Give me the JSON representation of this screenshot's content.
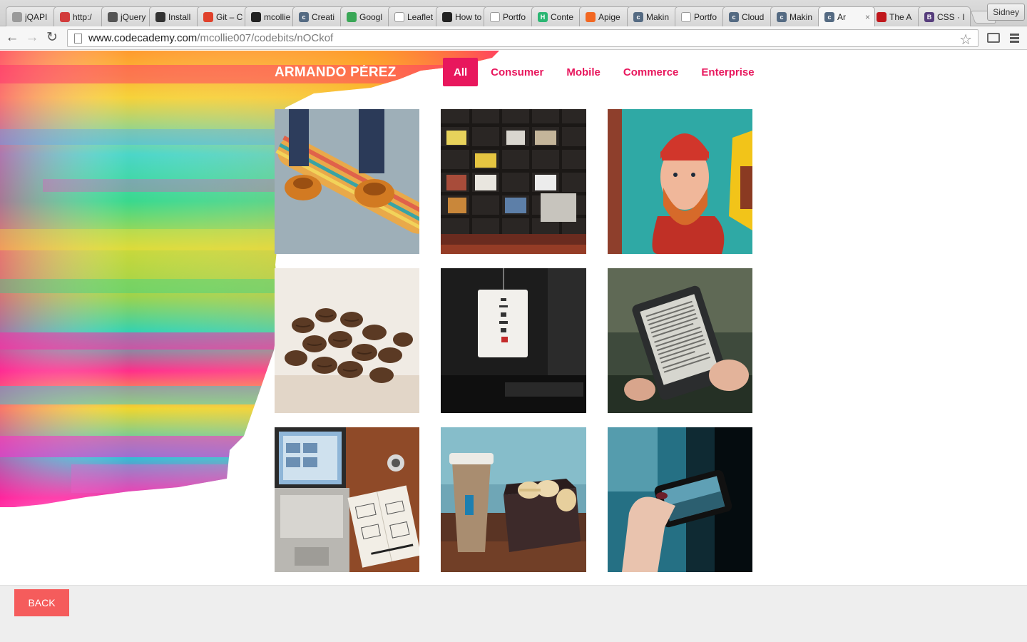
{
  "browser": {
    "tabs": [
      {
        "label": "jQAPI",
        "fav_color": "#9a9a9a",
        "fav_glyph": ""
      },
      {
        "label": "http:/",
        "fav_color": "#d23c3c",
        "fav_glyph": ""
      },
      {
        "label": "jQuery",
        "fav_color": "#555555",
        "fav_glyph": ""
      },
      {
        "label": "Install",
        "fav_color": "#333333",
        "fav_glyph": ""
      },
      {
        "label": "Git – C",
        "fav_color": "#e0412b",
        "fav_glyph": ""
      },
      {
        "label": "mcollie",
        "fav_color": "#222222",
        "fav_glyph": ""
      },
      {
        "label": "Creati",
        "fav_color": "#546a82",
        "fav_glyph": "c"
      },
      {
        "label": "Googl",
        "fav_color": "#3aa757",
        "fav_glyph": ""
      },
      {
        "label": "Leaflet",
        "fav_color": "#ffffff",
        "fav_glyph": ""
      },
      {
        "label": "How to",
        "fav_color": "#222222",
        "fav_glyph": ""
      },
      {
        "label": "Portfo",
        "fav_color": "#ffffff",
        "fav_glyph": ""
      },
      {
        "label": "Conte",
        "fav_color": "#2bb673",
        "fav_glyph": "H"
      },
      {
        "label": "Apige",
        "fav_color": "#f26722",
        "fav_glyph": ""
      },
      {
        "label": "Makin",
        "fav_color": "#546a82",
        "fav_glyph": "c"
      },
      {
        "label": "Portfo",
        "fav_color": "#ffffff",
        "fav_glyph": ""
      },
      {
        "label": "Cloud",
        "fav_color": "#546a82",
        "fav_glyph": "c"
      },
      {
        "label": "Makin",
        "fav_color": "#546a82",
        "fav_glyph": "c"
      },
      {
        "label": "Ar",
        "fav_color": "#546a82",
        "fav_glyph": "c",
        "active": true
      },
      {
        "label": "The A",
        "fav_color": "#c0171c",
        "fav_glyph": ""
      },
      {
        "label": "CSS · I",
        "fav_color": "#563d7c",
        "fav_glyph": "B"
      }
    ],
    "tab_close_glyph": "×",
    "profile_name": "Sidney",
    "url_host": "www.codecademy.com",
    "url_path": "/mcollie007/codebits/nOCkof",
    "back_glyph": "←",
    "forward_glyph": "→",
    "reload_glyph": "↻",
    "star_glyph": "☆"
  },
  "site": {
    "brand": "ARMANDO PÉREZ",
    "filters": [
      {
        "label": "All",
        "active": true
      },
      {
        "label": "Consumer",
        "active": false
      },
      {
        "label": "Mobile",
        "active": false
      },
      {
        "label": "Commerce",
        "active": false
      },
      {
        "label": "Enterprise",
        "active": false
      }
    ],
    "accent_color": "#e8175d",
    "tiles": [
      {
        "name": "skateboard-photo"
      },
      {
        "name": "bookshelf-photo"
      },
      {
        "name": "mural-photo"
      },
      {
        "name": "coffee-beans-photo"
      },
      {
        "name": "lantern-photo"
      },
      {
        "name": "ereader-photo"
      },
      {
        "name": "laptop-desk-photo"
      },
      {
        "name": "coffee-macarons-photo"
      },
      {
        "name": "phone-camera-photo"
      }
    ]
  },
  "footer": {
    "back_label": "BACK",
    "back_color": "#f55c5c"
  }
}
